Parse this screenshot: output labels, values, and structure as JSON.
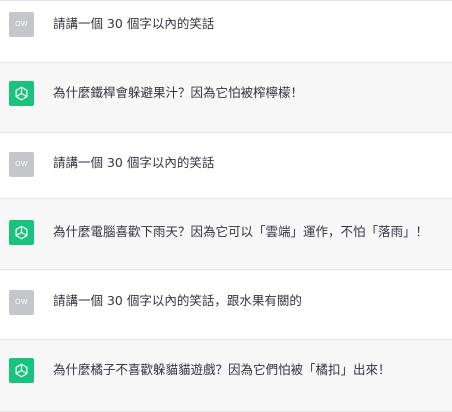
{
  "user_avatar_initials": "OW",
  "colors": {
    "assistant_bg": "#f7f7f8",
    "user_bg": "#ffffff",
    "bot_avatar": "#19c37d",
    "user_avatar": "#c5c5cc",
    "text": "#343541"
  },
  "messages": [
    {
      "role": "user",
      "text": "請講一個 30 個字以內的笑話"
    },
    {
      "role": "assistant",
      "icon": "openai-logo-icon",
      "text": "為什麼鐵桿會躲避果汁？因為它怕被榨檸檬！"
    },
    {
      "role": "user",
      "text": "請講一個 30 個字以內的笑話"
    },
    {
      "role": "assistant",
      "icon": "openai-logo-icon",
      "text": "為什麼電腦喜歡下雨天？因為它可以「雲端」運作，不怕「落雨」！"
    },
    {
      "role": "user",
      "text": "請講一個 30 個字以內的笑話，跟水果有關的"
    },
    {
      "role": "assistant",
      "icon": "openai-logo-icon",
      "text": "為什麼橘子不喜歡躲貓貓遊戲？因為它們怕被「橘扣」出來！"
    }
  ]
}
